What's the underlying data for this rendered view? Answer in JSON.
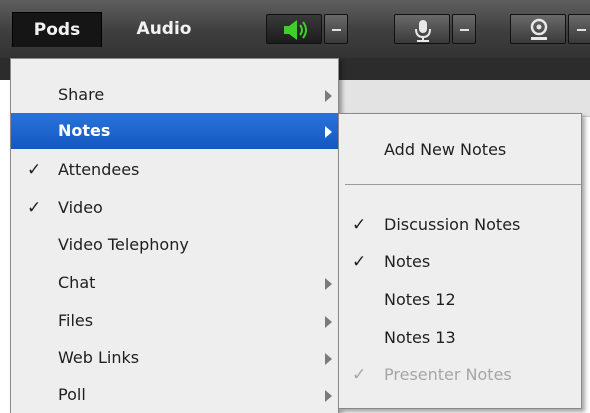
{
  "menubar": {
    "menus": [
      "Pods",
      "Audio"
    ],
    "buttons": [
      {
        "name": "speaker-icon",
        "active": true,
        "accent": "#3fcf2a"
      },
      {
        "name": "microphone-icon",
        "active": false
      },
      {
        "name": "webcam-icon",
        "active": false
      }
    ]
  },
  "pods_menu": {
    "items": [
      {
        "label": "Share",
        "checked": false,
        "submenu": true,
        "highlighted": false
      },
      {
        "label": "Notes",
        "checked": false,
        "submenu": true,
        "highlighted": true
      },
      {
        "label": "Attendees",
        "checked": true,
        "submenu": false,
        "highlighted": false
      },
      {
        "label": "Video",
        "checked": true,
        "submenu": false,
        "highlighted": false
      },
      {
        "label": "Video Telephony",
        "checked": false,
        "submenu": false,
        "highlighted": false
      },
      {
        "label": "Chat",
        "checked": false,
        "submenu": true,
        "highlighted": false
      },
      {
        "label": "Files",
        "checked": false,
        "submenu": true,
        "highlighted": false
      },
      {
        "label": "Web Links",
        "checked": false,
        "submenu": true,
        "highlighted": false
      },
      {
        "label": "Poll",
        "checked": false,
        "submenu": true,
        "highlighted": false
      }
    ]
  },
  "notes_submenu": {
    "add_label": "Add New Notes",
    "items": [
      {
        "label": "Discussion Notes",
        "checked": true,
        "disabled": false
      },
      {
        "label": "Notes",
        "checked": true,
        "disabled": false
      },
      {
        "label": "Notes 12",
        "checked": false,
        "disabled": false
      },
      {
        "label": "Notes 13",
        "checked": false,
        "disabled": false
      },
      {
        "label": "Presenter Notes",
        "checked": true,
        "disabled": true
      }
    ]
  },
  "check_glyph": "✓",
  "colors": {
    "highlight": "#1a63cf",
    "menu_bg": "#eeeeee",
    "disabled_text": "#a6a6a6"
  }
}
